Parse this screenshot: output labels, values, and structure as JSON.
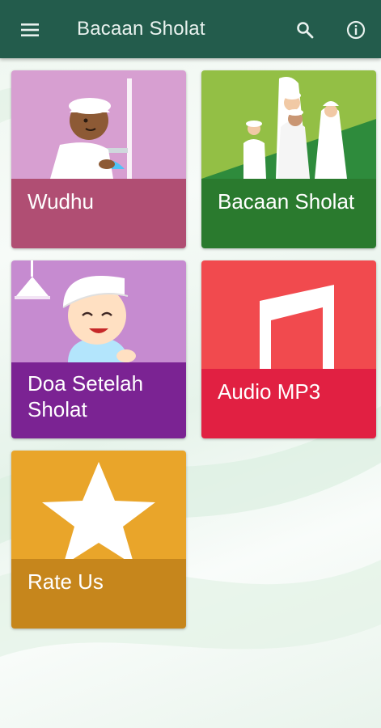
{
  "appbar": {
    "title": "Bacaan Sholat",
    "menu_icon": "hamburger-menu-icon",
    "search_icon": "search-icon",
    "info_icon": "info-icon",
    "color": "#235c4c"
  },
  "menu": {
    "items": [
      {
        "label": "Wudhu",
        "art_color": "#d79fd1",
        "label_color": "#b04e73",
        "icon": "child-washing-icon"
      },
      {
        "label": "Bacaan Sholat",
        "art_color": "#93bf45",
        "label_color": "#2a7a2e",
        "icon": "family-praying-icon"
      },
      {
        "label": "Doa Setelah Sholat",
        "art_color": "#c68bd0",
        "label_color": "#7b2393",
        "icon": "boy-praying-icon"
      },
      {
        "label": "Audio MP3",
        "art_color": "#f14a4e",
        "label_color": "#e12042",
        "icon": "music-note-icon"
      },
      {
        "label": "Rate Us",
        "art_color": "#e9a52a",
        "label_color": "#c6861c",
        "icon": "star-icon"
      }
    ]
  }
}
